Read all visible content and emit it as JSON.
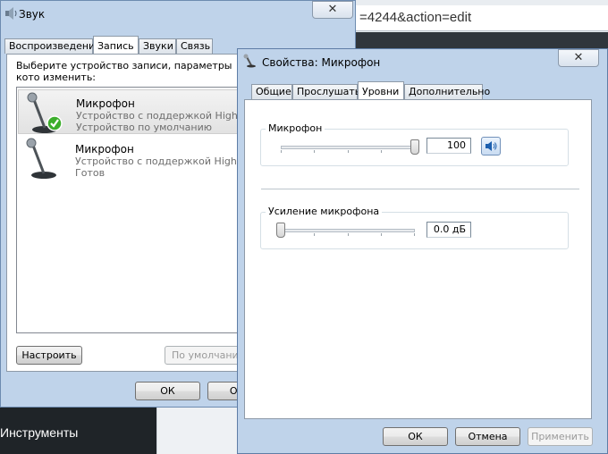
{
  "background_browser": {
    "url_fragment": "=4244&action=edit",
    "sidebar_item": "Инструменты"
  },
  "sound_window": {
    "title": "Звук",
    "close_glyph": "✕",
    "tabs": [
      "Воспроизведение",
      "Запись",
      "Звуки",
      "Связь"
    ],
    "active_tab": "Запись",
    "description": "Выберите устройство записи, параметры кото изменить:",
    "devices": [
      {
        "name": "Микрофон",
        "line2": "Устройство с поддержкой High Def",
        "line3": "Устройство по умолчанию",
        "selected": true,
        "default_check": true
      },
      {
        "name": "Микрофон",
        "line2": "Устройство с поддержкой High Def",
        "line3": "Готов",
        "selected": false,
        "default_check": false
      }
    ],
    "configure_button": "Настроить",
    "default_button": "По умолчанию",
    "ok_button": "ОК",
    "cancel_button": "Отм"
  },
  "props_window": {
    "title": "Свойства: Микрофон",
    "close_glyph": "✕",
    "tabs": [
      "Общие",
      "Прослушать",
      "Уровни",
      "Дополнительно"
    ],
    "active_tab": "Уровни",
    "microphone": {
      "label": "Микрофон",
      "value": "100",
      "level": 1.0
    },
    "boost": {
      "label": "Усиление микрофона",
      "value": "0.0 дБ",
      "level": 0.0
    },
    "ok_button": "ОК",
    "cancel_button": "Отмена",
    "apply_button": "Применить"
  },
  "colors": {
    "aero_frame": "#bfd3ea",
    "selection": "#e6e6e6",
    "check_green": "#3cae2c"
  }
}
